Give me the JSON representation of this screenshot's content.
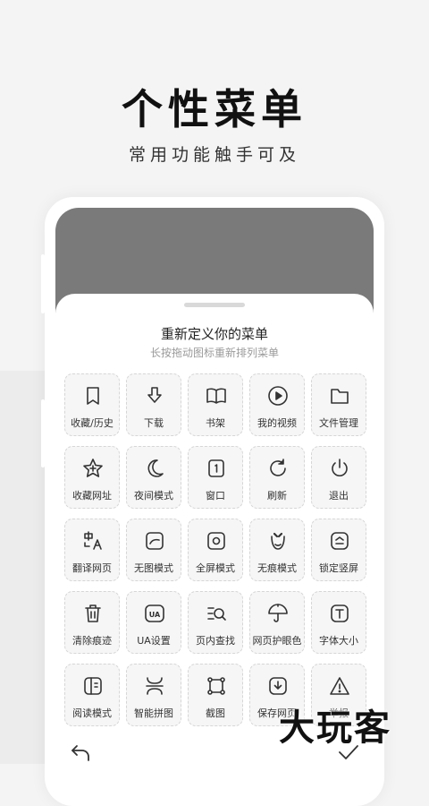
{
  "hero": {
    "title": "个性菜单",
    "subtitle": "常用功能触手可及"
  },
  "sheet": {
    "title": "重新定义你的菜单",
    "subtitle": "长按拖动图标重新排列菜单",
    "items": [
      {
        "label": "收藏/历史",
        "icon": "bookmark-icon"
      },
      {
        "label": "下载",
        "icon": "download-icon"
      },
      {
        "label": "书架",
        "icon": "book-icon"
      },
      {
        "label": "我的视频",
        "icon": "play-icon"
      },
      {
        "label": "文件管理",
        "icon": "folder-icon"
      },
      {
        "label": "收藏网址",
        "icon": "star-plus-icon"
      },
      {
        "label": "夜间模式",
        "icon": "moon-icon"
      },
      {
        "label": "窗口",
        "icon": "window-icon"
      },
      {
        "label": "刷新",
        "icon": "refresh-icon"
      },
      {
        "label": "退出",
        "icon": "power-icon"
      },
      {
        "label": "翻译网页",
        "icon": "translate-icon"
      },
      {
        "label": "无图模式",
        "icon": "no-image-icon"
      },
      {
        "label": "全屏模式",
        "icon": "fullscreen-icon"
      },
      {
        "label": "无痕模式",
        "icon": "incognito-icon"
      },
      {
        "label": "锁定竖屏",
        "icon": "lock-portrait-icon"
      },
      {
        "label": "清除痕迹",
        "icon": "trash-icon"
      },
      {
        "label": "UA设置",
        "icon": "ua-icon"
      },
      {
        "label": "页内查找",
        "icon": "find-in-page-icon"
      },
      {
        "label": "网页护眼色",
        "icon": "umbrella-icon"
      },
      {
        "label": "字体大小",
        "icon": "font-size-icon"
      },
      {
        "label": "阅读模式",
        "icon": "reading-icon"
      },
      {
        "label": "智能拼图",
        "icon": "stitch-icon"
      },
      {
        "label": "截图",
        "icon": "screenshot-icon"
      },
      {
        "label": "保存网页",
        "icon": "save-page-icon"
      },
      {
        "label": "举报",
        "icon": "warning-icon"
      }
    ]
  },
  "bottom": {
    "back_icon": "back-arrow-icon",
    "confirm_icon": "check-icon"
  },
  "watermark": "大玩客"
}
